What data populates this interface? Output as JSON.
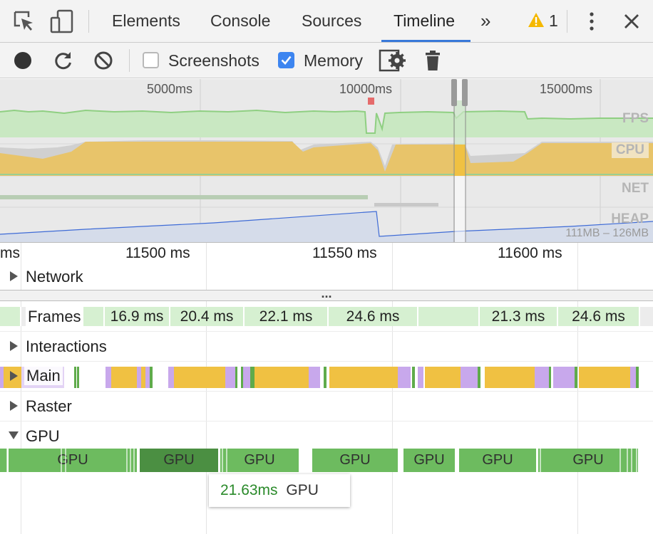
{
  "tabs": {
    "elements": "Elements",
    "console": "Console",
    "sources": "Sources",
    "timeline": "Timeline",
    "more": "»",
    "warning_count": "1"
  },
  "toolbar": {
    "screenshots_label": "Screenshots",
    "screenshots_checked": false,
    "memory_label": "Memory",
    "memory_checked": true
  },
  "overview": {
    "ticks": [
      "5000ms",
      "10000ms",
      "15000ms"
    ],
    "rows": {
      "fps": "FPS",
      "cpu": "CPU",
      "net": "NET",
      "heap": "HEAP"
    },
    "heap_range": "111MB – 126MB"
  },
  "details": {
    "ruler": [
      "ms",
      "11500 ms",
      "11550 ms",
      "11600 ms"
    ],
    "network_label": "Network",
    "resize_handle": "...",
    "frames_label": "Frames",
    "frames": [
      "16.9 ms",
      "20.4 ms",
      "22.1 ms",
      "24.6 ms",
      "",
      "21.3 ms",
      "24.6 ms"
    ],
    "interactions_label": "Interactions",
    "main_label": "Main",
    "raster_label": "Raster",
    "gpu_label": "GPU",
    "gpu_blocks": [
      "GPU",
      "GPU",
      "GPU",
      "GPU",
      "GPU",
      "GPU",
      "GPU"
    ]
  },
  "tooltip": {
    "duration": "21.63ms",
    "name": "GPU"
  },
  "colors": {
    "accent": "#3879d9",
    "fps": "#8fcf82",
    "cpu_scripting": "#e8c46a",
    "main_scripting": "#f0c142",
    "main_rendering": "#c8a8ec",
    "gpu": "#6dbb5f",
    "gpu_selected": "#4b8f42",
    "heap": "#3e6bd6",
    "tooltip_duration": "#2a8a2a",
    "warning": "#f5b800"
  }
}
